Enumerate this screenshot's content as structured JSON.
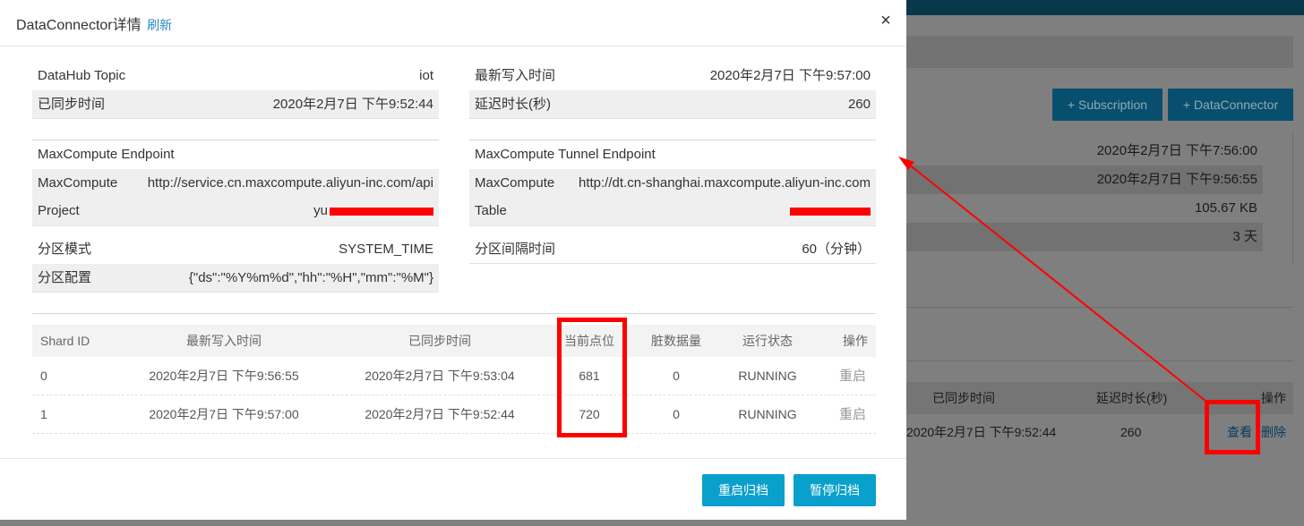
{
  "modal": {
    "title": "DataConnector详情",
    "refresh": "刷新",
    "close": "×",
    "fields": {
      "topic_label": "DataHub Topic",
      "topic_value": "iot",
      "latest_write_label": "最新写入时间",
      "latest_write_value": "2020年2月7日 下午9:57:00",
      "synced_time_label": "已同步时间",
      "synced_time_value": "2020年2月7日 下午9:52:44",
      "delay_label": "延迟时长(秒)",
      "delay_value": "260",
      "mc_endpoint_heading": "MaxCompute Endpoint",
      "mc_tunnel_heading": "MaxCompute Tunnel Endpoint",
      "mc_label": "MaxCompute",
      "mc_endpoint_value": "http://service.cn.maxcompute.aliyun-inc.com/api",
      "mc_tunnel_label": "MaxCompute",
      "mc_tunnel_value": "http://dt.cn-shanghai.maxcompute.aliyun-inc.com",
      "project_label": "Project",
      "project_value": "yu",
      "table_label": "Table",
      "partition_mode_label": "分区模式",
      "partition_mode_value": "SYSTEM_TIME",
      "partition_interval_label": "分区间隔时间",
      "partition_interval_value": "60（分钟）",
      "partition_config_label": "分区配置",
      "partition_config_value": "{\"ds\":\"%Y%m%d\",\"hh\":\"%H\",\"mm\":\"%M\"}"
    },
    "shard_table": {
      "headers": [
        "Shard ID",
        "最新写入时间",
        "已同步时间",
        "当前点位",
        "脏数据量",
        "运行状态",
        "操作"
      ],
      "rows": [
        {
          "shard_id": "0",
          "latest_write": "2020年2月7日 下午9:56:55",
          "synced": "2020年2月7日 下午9:53:04",
          "position": "681",
          "dirty": "0",
          "status": "RUNNING",
          "action": "重启"
        },
        {
          "shard_id": "1",
          "latest_write": "2020年2月7日 下午9:57:00",
          "synced": "2020年2月7日 下午9:52:44",
          "position": "720",
          "dirty": "0",
          "status": "RUNNING",
          "action": "重启"
        }
      ]
    },
    "buttons": {
      "restart_archive": "重启归档",
      "pause_archive": "暂停归档"
    }
  },
  "background": {
    "add_subscription": "+ Subscription",
    "add_dataconnector": "+ DataConnector",
    "info_values": [
      "2020年2月7日 下午7:56:00",
      "2020年2月7日 下午9:56:55",
      "105.67 KB",
      "3 天"
    ],
    "table_headers": {
      "synced": "已同步时间",
      "delay": "延迟时长(秒)",
      "action": "操作"
    },
    "table_row": {
      "synced": "2020年2月7日 下午9:52:44",
      "delay": "260",
      "view": "查看",
      "delete": "删除"
    }
  },
  "colors": {
    "accent": "#0aa0cc",
    "link": "#2a8ac4",
    "annotation": "#ff0000",
    "overlay_topbar": "#08384a"
  }
}
